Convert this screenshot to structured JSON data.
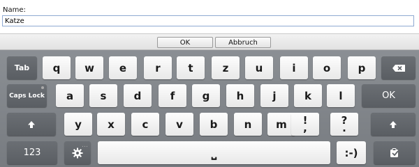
{
  "form": {
    "name_label": "Name:",
    "name_value": "Katze"
  },
  "dialog": {
    "ok_label": "OK",
    "cancel_label": "Abbruch"
  },
  "keyboard": {
    "row1": [
      "q",
      "w",
      "e",
      "r",
      "t",
      "z",
      "u",
      "i",
      "o",
      "p"
    ],
    "row2": [
      "a",
      "s",
      "d",
      "f",
      "g",
      "h",
      "j",
      "k",
      "l"
    ],
    "row3": [
      "y",
      "x",
      "c",
      "v",
      "b",
      "n",
      "m"
    ],
    "tab_label": "Tab",
    "caps_label": "Caps Lock",
    "ok_label": "OK",
    "num_label": "123",
    "smiley_label": ":-)",
    "space_glyph": "⎵",
    "excl_top": "!",
    "excl_bottom": ",",
    "quest_top": "?",
    "quest_bottom": ".",
    "icons": {
      "backspace": "backspace-icon",
      "shift": "shift-arrow-icon",
      "settings": "gear-icon",
      "clipboard": "clipboard-icon"
    },
    "colors": {
      "background": "#7f8388",
      "letter_key": "#f5f5f5",
      "function_key": "#63676c"
    }
  }
}
